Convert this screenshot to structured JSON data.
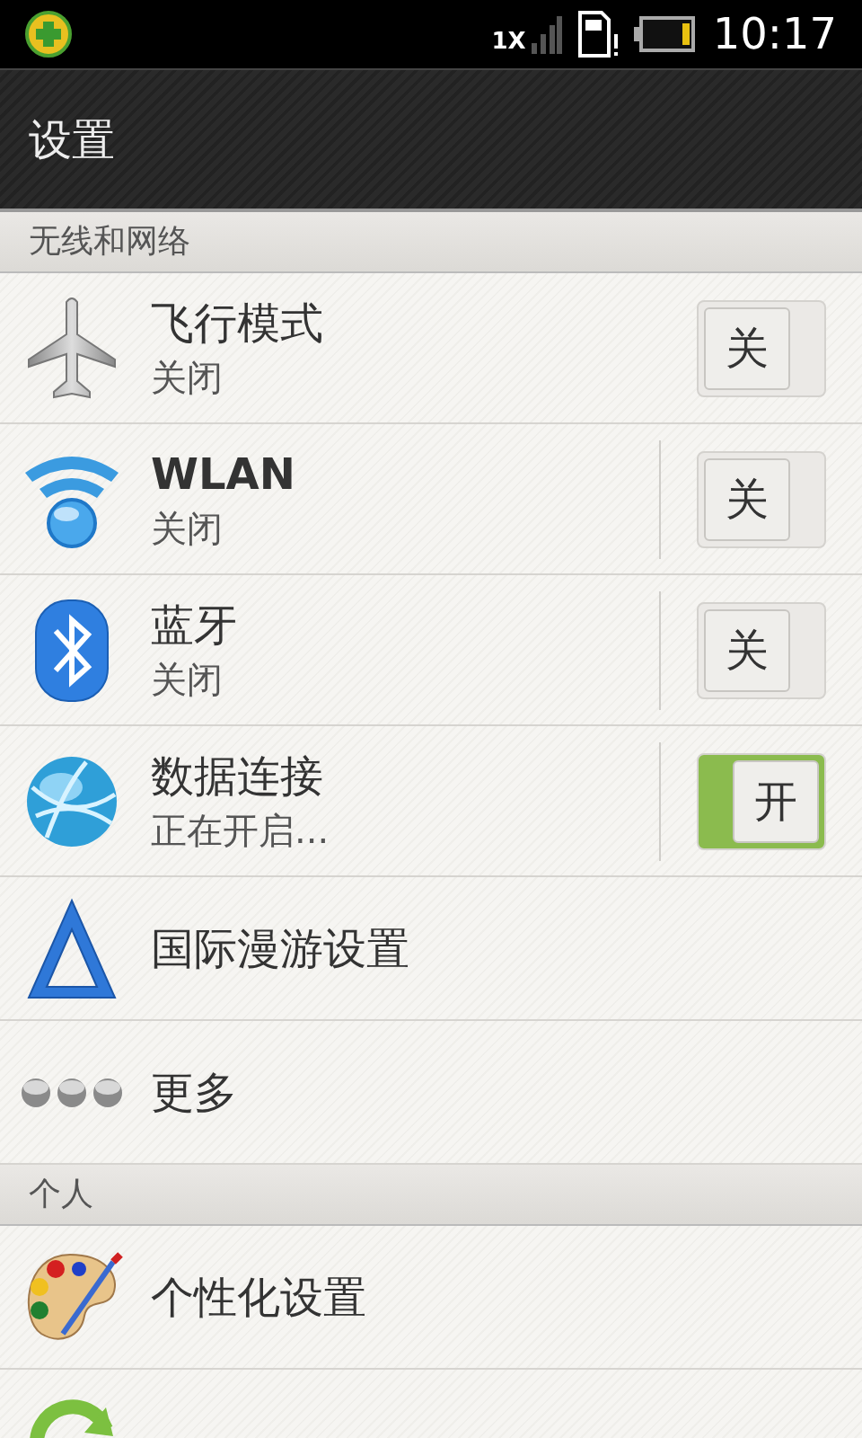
{
  "status_bar": {
    "network": "1X",
    "time": "10:17"
  },
  "title": "设置",
  "sections": [
    {
      "header": "无线和网络",
      "items": [
        {
          "kind": "switch",
          "title": "飞行模式",
          "subtitle": "关闭",
          "toggle": {
            "on": false,
            "label": "关"
          },
          "split": false
        },
        {
          "kind": "switch",
          "title": "WLAN",
          "subtitle": "关闭",
          "toggle": {
            "on": false,
            "label": "关"
          },
          "split": true
        },
        {
          "kind": "switch",
          "title": "蓝牙",
          "subtitle": "关闭",
          "toggle": {
            "on": false,
            "label": "关"
          },
          "split": true
        },
        {
          "kind": "switch",
          "title": "数据连接",
          "subtitle": "正在开启...",
          "toggle": {
            "on": true,
            "label": "开"
          },
          "split": true
        },
        {
          "kind": "link",
          "title": "国际漫游设置"
        },
        {
          "kind": "link",
          "title": "更多"
        }
      ]
    },
    {
      "header": "个人",
      "items": [
        {
          "kind": "link",
          "title": "个性化设置"
        },
        {
          "kind": "partial"
        }
      ]
    }
  ]
}
